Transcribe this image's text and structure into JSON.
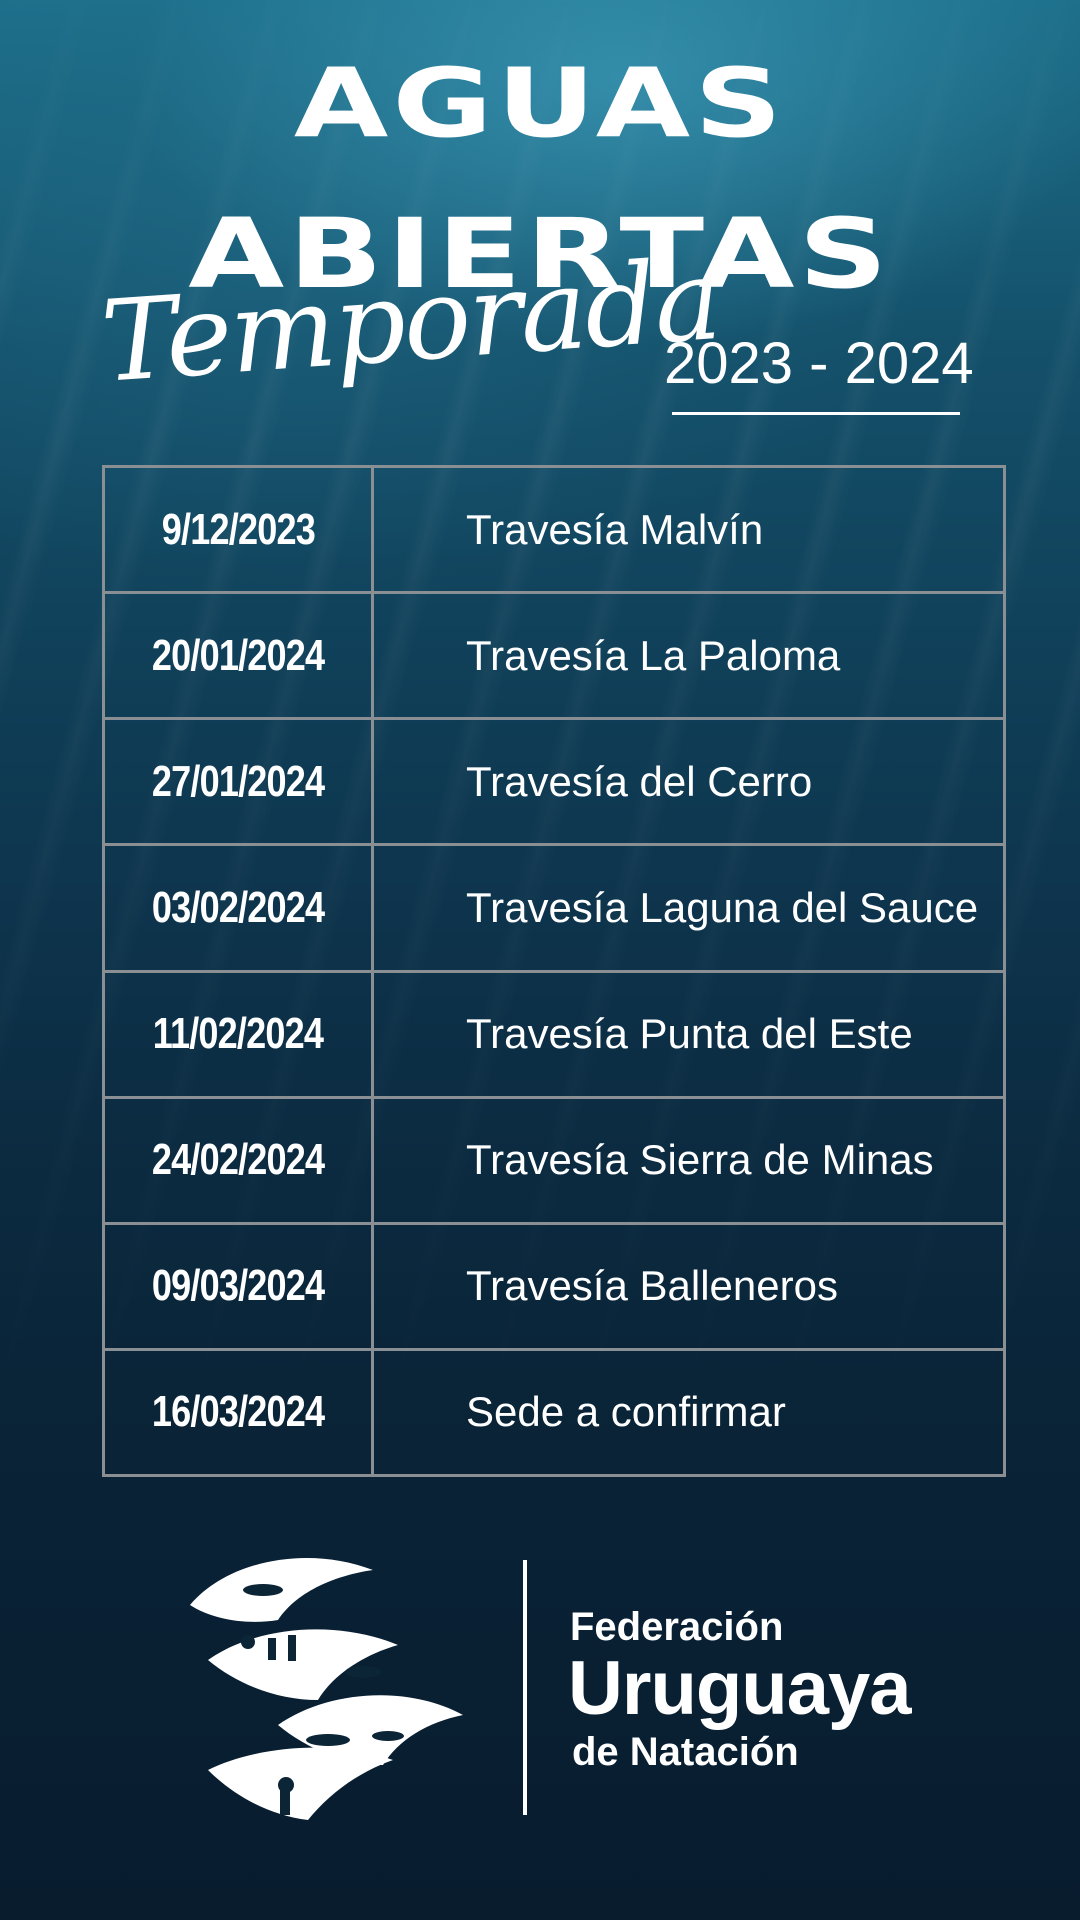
{
  "header": {
    "title_line1": "AGUAS",
    "title_line2": "ABIERTAS",
    "script_word": "Temporada",
    "season": "2023 - 2024"
  },
  "schedule": [
    {
      "date": "9/12/2023",
      "event": "Travesía Malvín"
    },
    {
      "date": "20/01/2024",
      "event": "Travesía La Paloma"
    },
    {
      "date": "27/01/2024",
      "event": "Travesía del Cerro"
    },
    {
      "date": "03/02/2024",
      "event": "Travesía Laguna del Sauce"
    },
    {
      "date": "11/02/2024",
      "event": "Travesía Punta del Este"
    },
    {
      "date": "24/02/2024",
      "event": "Travesía Sierra de Minas"
    },
    {
      "date": "09/03/2024",
      "event": "Travesía Balleneros"
    },
    {
      "date": "16/03/2024",
      "event": "Sede a confirmar"
    }
  ],
  "footer": {
    "org_line1": "Federación",
    "org_line2": "Uruguaya",
    "org_line3": "de Natación",
    "logo_icon": "swimmers-waves-logo"
  },
  "colors": {
    "text": "#ffffff",
    "grid_lines": "#8a8f94",
    "background_top": "#1d6f8a",
    "background_bottom": "#081c2e"
  }
}
